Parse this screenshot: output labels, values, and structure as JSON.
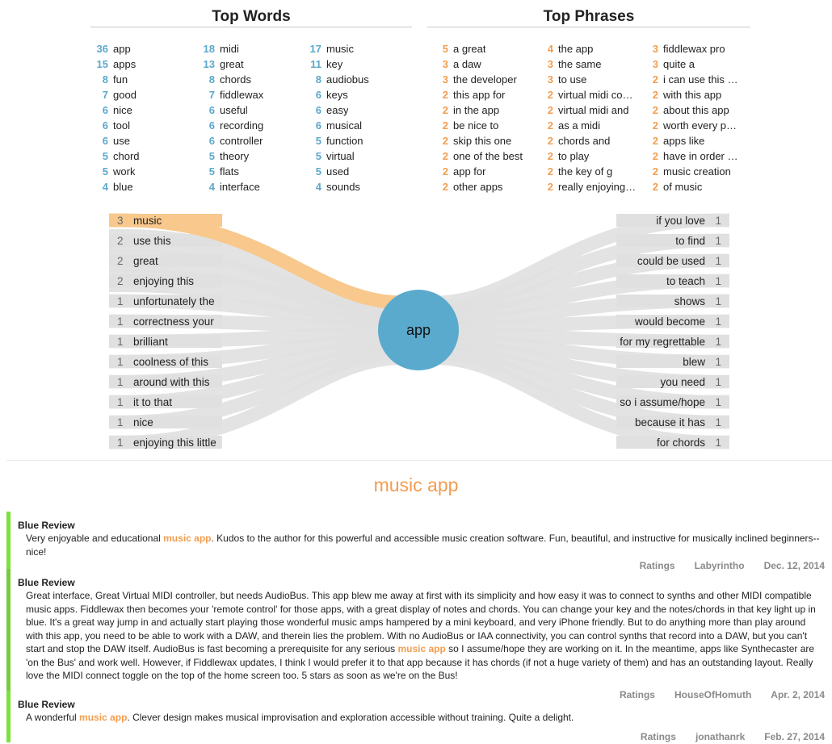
{
  "top_words": {
    "title": "Top Words",
    "columns": [
      [
        {
          "n": "36",
          "w": "app"
        },
        {
          "n": "15",
          "w": "apps"
        },
        {
          "n": "8",
          "w": "fun"
        },
        {
          "n": "7",
          "w": "good"
        },
        {
          "n": "6",
          "w": "nice"
        },
        {
          "n": "6",
          "w": "tool"
        },
        {
          "n": "6",
          "w": "use"
        },
        {
          "n": "5",
          "w": "chord"
        },
        {
          "n": "5",
          "w": "work"
        },
        {
          "n": "4",
          "w": "blue"
        }
      ],
      [
        {
          "n": "18",
          "w": "midi"
        },
        {
          "n": "13",
          "w": "great"
        },
        {
          "n": "8",
          "w": "chords"
        },
        {
          "n": "7",
          "w": "fiddlewax"
        },
        {
          "n": "6",
          "w": "useful"
        },
        {
          "n": "6",
          "w": "recording"
        },
        {
          "n": "6",
          "w": "controller"
        },
        {
          "n": "5",
          "w": "theory"
        },
        {
          "n": "5",
          "w": "flats"
        },
        {
          "n": "4",
          "w": "interface"
        }
      ],
      [
        {
          "n": "17",
          "w": "music"
        },
        {
          "n": "11",
          "w": "key"
        },
        {
          "n": "8",
          "w": "audiobus"
        },
        {
          "n": "6",
          "w": "keys"
        },
        {
          "n": "6",
          "w": "easy"
        },
        {
          "n": "6",
          "w": "musical"
        },
        {
          "n": "5",
          "w": "function"
        },
        {
          "n": "5",
          "w": "virtual"
        },
        {
          "n": "5",
          "w": "used"
        },
        {
          "n": "4",
          "w": "sounds"
        }
      ]
    ]
  },
  "top_phrases": {
    "title": "Top Phrases",
    "columns": [
      [
        {
          "n": "5",
          "w": "a great"
        },
        {
          "n": "3",
          "w": "a daw"
        },
        {
          "n": "3",
          "w": "the developer"
        },
        {
          "n": "2",
          "w": "this app for"
        },
        {
          "n": "2",
          "w": "in the app"
        },
        {
          "n": "2",
          "w": "be nice to"
        },
        {
          "n": "2",
          "w": "skip this one"
        },
        {
          "n": "2",
          "w": "one of the best"
        },
        {
          "n": "2",
          "w": "app for"
        },
        {
          "n": "2",
          "w": "other apps"
        }
      ],
      [
        {
          "n": "4",
          "w": "the app"
        },
        {
          "n": "3",
          "w": "the same"
        },
        {
          "n": "3",
          "w": "to use"
        },
        {
          "n": "2",
          "w": "virtual midi co…"
        },
        {
          "n": "2",
          "w": "virtual midi and"
        },
        {
          "n": "2",
          "w": "as a midi"
        },
        {
          "n": "2",
          "w": "chords and"
        },
        {
          "n": "2",
          "w": "to play"
        },
        {
          "n": "2",
          "w": "the key of g"
        },
        {
          "n": "2",
          "w": "really enjoying…"
        }
      ],
      [
        {
          "n": "3",
          "w": "fiddlewax pro"
        },
        {
          "n": "3",
          "w": "quite a"
        },
        {
          "n": "2",
          "w": "i can use this …"
        },
        {
          "n": "2",
          "w": "with this app"
        },
        {
          "n": "2",
          "w": "about this app"
        },
        {
          "n": "2",
          "w": "worth every p…"
        },
        {
          "n": "2",
          "w": "apps like"
        },
        {
          "n": "2",
          "w": "have in order …"
        },
        {
          "n": "2",
          "w": "music creation"
        },
        {
          "n": "2",
          "w": "of music"
        }
      ]
    ]
  },
  "word_tree": {
    "center": "app",
    "colors": {
      "center": "#5aaacd",
      "selected": "#f8c88c",
      "link": "#e0e0e0"
    },
    "selected_index": 0,
    "left": [
      {
        "n": "3",
        "w": "music"
      },
      {
        "n": "2",
        "w": "use this"
      },
      {
        "n": "2",
        "w": "great"
      },
      {
        "n": "2",
        "w": "enjoying this"
      },
      {
        "n": "1",
        "w": "unfortunately the"
      },
      {
        "n": "1",
        "w": "correctness your"
      },
      {
        "n": "1",
        "w": "brilliant"
      },
      {
        "n": "1",
        "w": "coolness of this"
      },
      {
        "n": "1",
        "w": "around with this"
      },
      {
        "n": "1",
        "w": "it to that"
      },
      {
        "n": "1",
        "w": "nice"
      },
      {
        "n": "1",
        "w": "enjoying this little"
      }
    ],
    "right": [
      {
        "n": "1",
        "w": "if you love"
      },
      {
        "n": "1",
        "w": "to find"
      },
      {
        "n": "1",
        "w": "could be used"
      },
      {
        "n": "1",
        "w": "to teach"
      },
      {
        "n": "1",
        "w": "shows"
      },
      {
        "n": "1",
        "w": "would become"
      },
      {
        "n": "1",
        "w": "for my regrettable"
      },
      {
        "n": "1",
        "w": "blew"
      },
      {
        "n": "1",
        "w": "you need"
      },
      {
        "n": "1",
        "w": "so i assume/hope"
      },
      {
        "n": "1",
        "w": "because it has"
      },
      {
        "n": "1",
        "w": "for chords"
      }
    ]
  },
  "selected_phrase": "music app",
  "reviews": [
    {
      "title": "Blue Review",
      "parts": [
        "Very enjoyable and educational ",
        "music app",
        ". Kudos to the author for this powerful and accessible music creation software. Fun, beautiful, and instructive for musically inclined beginners--nice!"
      ],
      "ratings": "Ratings",
      "author": "Labyrintho",
      "date": "Dec. 12, 2014"
    },
    {
      "title": "Blue Review",
      "parts": [
        "Great interface, Great Virtual MIDI controller, but needs AudioBus. This app blew me away at first with its simplicity and how easy it was to connect to synths and other MIDI compatible music apps. Fiddlewax then becomes your 'remote control' for those apps, with a great display of notes and chords. You can change your key and the notes/chords in that key light up in blue. It's a great way jump in and actually start playing those wonderful music amps hampered by a mini keyboard, and very iPhone friendly. But to do anything more than play around with this app, you need to be able to work with a DAW, and therein lies the problem. With no AudioBus or IAA connectivity, you can control synths that record into a DAW, but you can't start and stop the DAW itself. AudioBus is fast becoming a prerequisite for any serious ",
        "music app",
        " so I assume/hope they are working on it. In the meantime, apps like Synthecaster are 'on the Bus' and work well. However, if Fiddlewax updates, I think I would prefer it to that app because it has chords (if not a huge variety of them) and has an outstanding layout. Really love the MIDI connect toggle on the top of the home screen too. 5 stars as soon as we're on the Bus!"
      ],
      "ratings": "Ratings",
      "author": "HouseOfHomuth",
      "date": "Apr. 2, 2014"
    },
    {
      "title": "Blue Review",
      "parts": [
        "A wonderful ",
        "music app",
        ". Clever design makes musical improvisation and exploration accessible without training. Quite a delight."
      ],
      "ratings": "Ratings",
      "author": "jonathanrk",
      "date": "Feb. 27, 2014"
    }
  ]
}
